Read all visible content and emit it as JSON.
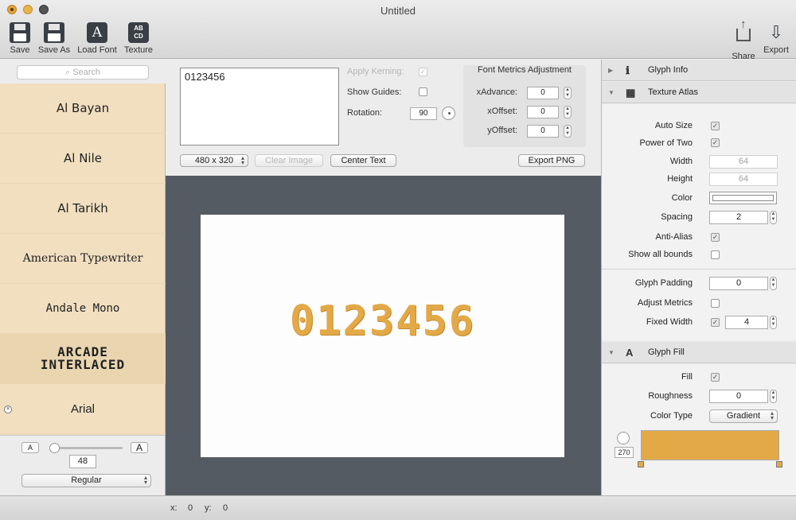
{
  "window": {
    "title": "Untitled"
  },
  "toolbar": {
    "save": "Save",
    "save_as": "Save As",
    "load_font": "Load Font",
    "texture": "Texture",
    "texture_icon_text": "AB\nCD",
    "share": "Share",
    "export": "Export"
  },
  "sidebar": {
    "search_placeholder": "Search",
    "fonts": [
      {
        "name": "Al Bayan"
      },
      {
        "name": "Al Nile"
      },
      {
        "name": "Al Tarikh"
      },
      {
        "name": "American Typewriter"
      },
      {
        "name": "Andale Mono"
      },
      {
        "name": "ARCADE INTERLACED"
      },
      {
        "name": "Arial"
      }
    ],
    "selected_font": "ARCADE INTERLACED",
    "small_a": "A",
    "large_a": "A",
    "font_size": "48",
    "font_style": "Regular"
  },
  "editor": {
    "text": "0123456",
    "apply_kerning_label": "Apply Kerning:",
    "apply_kerning_checked": true,
    "show_guides_label": "Show Guides:",
    "show_guides_checked": false,
    "rotation_label": "Rotation:",
    "rotation_value": "90",
    "metrics_title": "Font Metrics Adjustment",
    "x_advance_label": "xAdvance:",
    "x_advance_value": "0",
    "x_offset_label": "xOffset:",
    "x_offset_value": "0",
    "y_offset_label": "yOffset:",
    "y_offset_value": "0",
    "canvas_size": "480 x 320",
    "clear_image": "Clear Image",
    "center_text": "Center Text",
    "export_png": "Export PNG",
    "preview_text": "0123456"
  },
  "inspector": {
    "glyph_info": "Glyph Info",
    "texture_atlas": "Texture Atlas",
    "auto_size_label": "Auto Size",
    "auto_size_checked": true,
    "power_of_two_label": "Power of Two",
    "power_of_two_checked": true,
    "width_label": "Width",
    "width_value": "64",
    "height_label": "Height",
    "height_value": "64",
    "color_label": "Color",
    "spacing_label": "Spacing",
    "spacing_value": "2",
    "anti_alias_label": "Anti-Alias",
    "anti_alias_checked": true,
    "show_all_bounds_label": "Show all bounds",
    "show_all_bounds_checked": false,
    "glyph_padding_label": "Glyph Padding",
    "glyph_padding_value": "0",
    "adjust_metrics_label": "Adjust Metrics",
    "adjust_metrics_checked": false,
    "fixed_width_label": "Fixed Width",
    "fixed_width_checked": true,
    "fixed_width_value": "4",
    "glyph_fill": "Glyph Fill",
    "fill_label": "Fill",
    "fill_checked": true,
    "roughness_label": "Roughness",
    "roughness_value": "0",
    "color_type_label": "Color Type",
    "color_type_value": "Gradient",
    "gradient_angle": "270",
    "gradient_color": "#e3a947"
  },
  "status": {
    "x_label": "x:",
    "x_value": "0",
    "y_label": "y:",
    "y_value": "0"
  },
  "colors": {
    "sidebar_bg": "#f1dfc0",
    "canvas_bg": "#555b62",
    "glyph_color": "#e3a947"
  }
}
